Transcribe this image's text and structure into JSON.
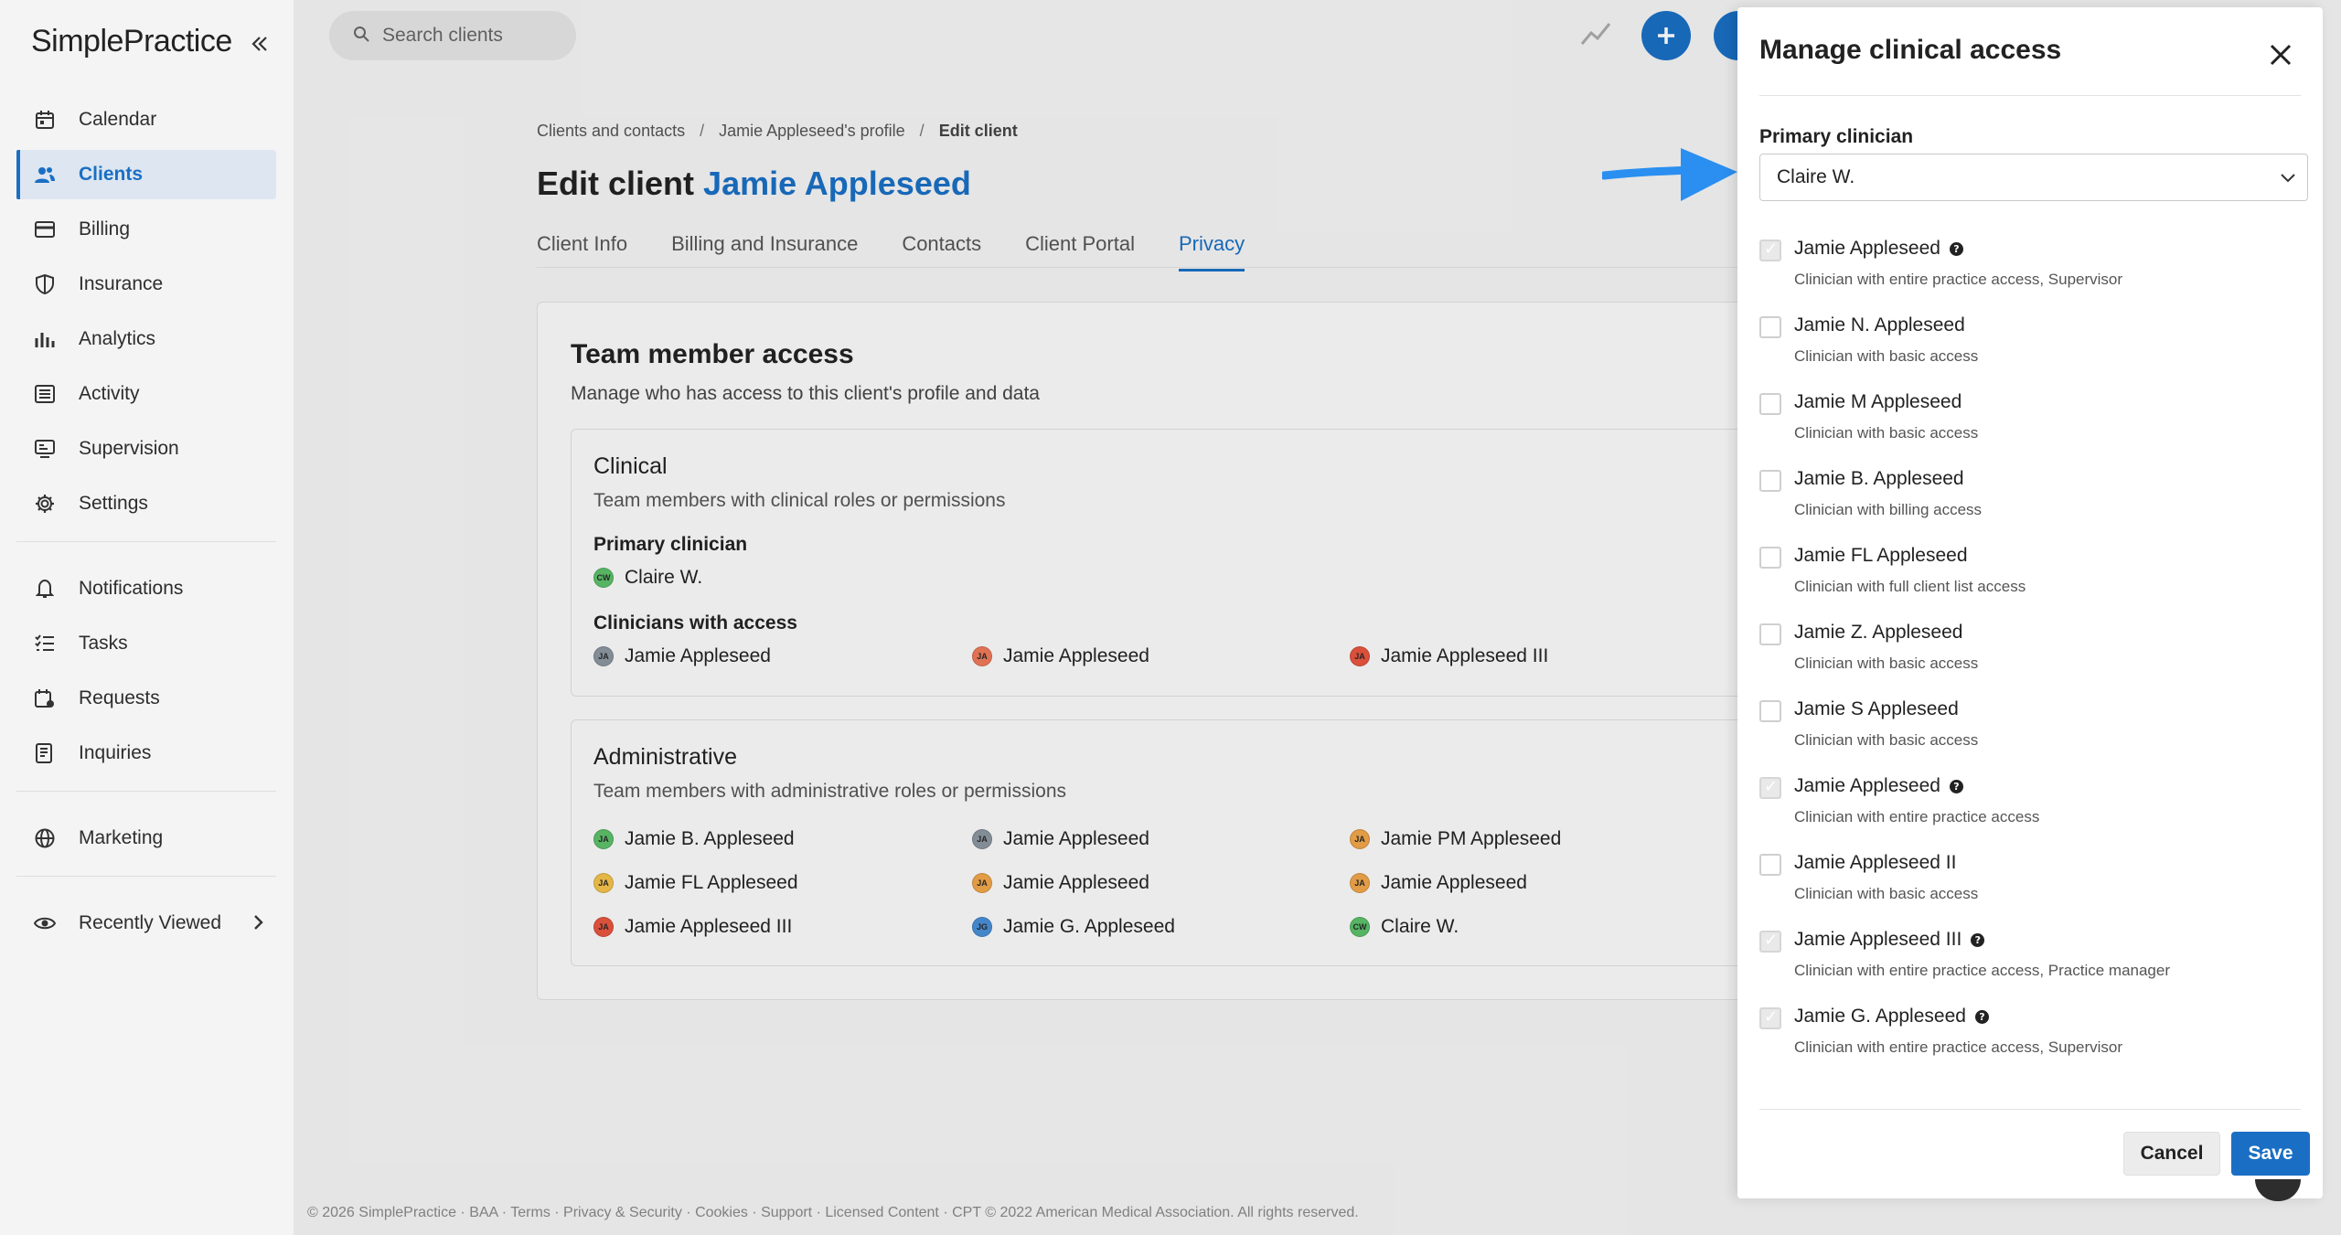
{
  "app": {
    "logo": "SimplePractice"
  },
  "sidebar": {
    "items": [
      {
        "label": "Calendar",
        "icon": "calendar-icon"
      },
      {
        "label": "Clients",
        "icon": "users-icon",
        "active": true
      },
      {
        "label": "Billing",
        "icon": "credit-card-icon"
      },
      {
        "label": "Insurance",
        "icon": "shield-icon"
      },
      {
        "label": "Analytics",
        "icon": "bar-chart-icon"
      },
      {
        "label": "Activity",
        "icon": "list-icon"
      },
      {
        "label": "Supervision",
        "icon": "supervision-icon"
      },
      {
        "label": "Settings",
        "icon": "gear-icon"
      }
    ],
    "items2": [
      {
        "label": "Notifications",
        "icon": "bell-icon"
      },
      {
        "label": "Tasks",
        "icon": "tasks-icon"
      },
      {
        "label": "Requests",
        "icon": "calendar-request-icon"
      },
      {
        "label": "Inquiries",
        "icon": "inquiries-icon"
      }
    ],
    "items3": [
      {
        "label": "Marketing",
        "icon": "globe-icon"
      }
    ],
    "recently_viewed": "Recently Viewed"
  },
  "topbar": {
    "search_placeholder": "Search clients"
  },
  "breadcrumb": {
    "root": "Clients and contacts",
    "profile": "Jamie Appleseed's profile",
    "current": "Edit client",
    "sep": "/"
  },
  "page": {
    "title_prefix": "Edit client",
    "client_name": "Jamie Appleseed",
    "tabs": [
      "Client Info",
      "Billing and Insurance",
      "Contacts",
      "Client Portal",
      "Privacy"
    ]
  },
  "team_access": {
    "title": "Team member access",
    "subtitle": "Manage who has access to this client's profile and data",
    "clinical": {
      "title": "Clinical",
      "subtitle": "Team members with clinical roles or permissions",
      "primary_label": "Primary clinician",
      "primary": {
        "initials": "CW",
        "name": "Claire W.",
        "color": "#5cc06a"
      },
      "clinicians_label": "Clinicians with access",
      "clinicians": [
        {
          "initials": "JA",
          "name": "Jamie Appleseed",
          "color": "#8c96a0"
        },
        {
          "initials": "JA",
          "name": "Jamie Appleseed",
          "color": "#ef7a5a"
        },
        {
          "initials": "JA",
          "name": "Jamie Appleseed III",
          "color": "#e8553f"
        }
      ]
    },
    "administrative": {
      "title": "Administrative",
      "subtitle": "Team members with administrative roles or permissions",
      "members": [
        {
          "initials": "JA",
          "name": "Jamie B. Appleseed",
          "color": "#5cc06a"
        },
        {
          "initials": "JA",
          "name": "Jamie Appleseed",
          "color": "#8c96a0"
        },
        {
          "initials": "JA",
          "name": "Jamie PM Appleseed",
          "color": "#f0a64a"
        },
        {
          "initials": "JA",
          "name": "Jamie FL Appleseed",
          "color": "#f3c24a"
        },
        {
          "initials": "JA",
          "name": "Jamie Appleseed",
          "color": "#f0a64a"
        },
        {
          "initials": "JA",
          "name": "Jamie Appleseed",
          "color": "#f0a64a"
        },
        {
          "initials": "JA",
          "name": "Jamie Appleseed III",
          "color": "#e8553f"
        },
        {
          "initials": "JG",
          "name": "Jamie G. Appleseed",
          "color": "#4a8fd8"
        },
        {
          "initials": "CW",
          "name": "Claire W.",
          "color": "#5cc06a"
        }
      ]
    }
  },
  "footer": "© 2026 SimplePractice · BAA · Terms · Privacy & Security · Cookies · Support · Licensed Content · CPT © 2022 American Medical Association. All rights reserved.",
  "drawer": {
    "title": "Manage clinical access",
    "primary_label": "Primary clinician",
    "primary_value": "Claire W.",
    "clinicians": [
      {
        "name": "Jamie Appleseed",
        "desc": "Clinician with entire practice access, Supervisor",
        "checked": true,
        "help": true
      },
      {
        "name": "Jamie N. Appleseed",
        "desc": "Clinician with basic access",
        "checked": false,
        "help": false
      },
      {
        "name": "Jamie M Appleseed",
        "desc": "Clinician with basic access",
        "checked": false,
        "help": false
      },
      {
        "name": "Jamie B. Appleseed",
        "desc": "Clinician with billing access",
        "checked": false,
        "help": false
      },
      {
        "name": "Jamie FL Appleseed",
        "desc": "Clinician with full client list access",
        "checked": false,
        "help": false
      },
      {
        "name": "Jamie Z. Appleseed",
        "desc": "Clinician with basic access",
        "checked": false,
        "help": false
      },
      {
        "name": "Jamie S Appleseed",
        "desc": "Clinician with basic access",
        "checked": false,
        "help": false
      },
      {
        "name": "Jamie Appleseed",
        "desc": "Clinician with entire practice access",
        "checked": true,
        "help": true
      },
      {
        "name": "Jamie Appleseed II",
        "desc": "Clinician with basic access",
        "checked": false,
        "help": false
      },
      {
        "name": "Jamie Appleseed III",
        "desc": "Clinician with entire practice access, Practice manager",
        "checked": true,
        "help": true
      },
      {
        "name": "Jamie G. Appleseed",
        "desc": "Clinician with entire practice access, Supervisor",
        "checked": true,
        "help": true
      }
    ],
    "help_glyph": "?",
    "cancel": "Cancel",
    "save": "Save"
  },
  "colors": {
    "accent": "#1a6fc4",
    "arrow": "#2a8ff0"
  }
}
